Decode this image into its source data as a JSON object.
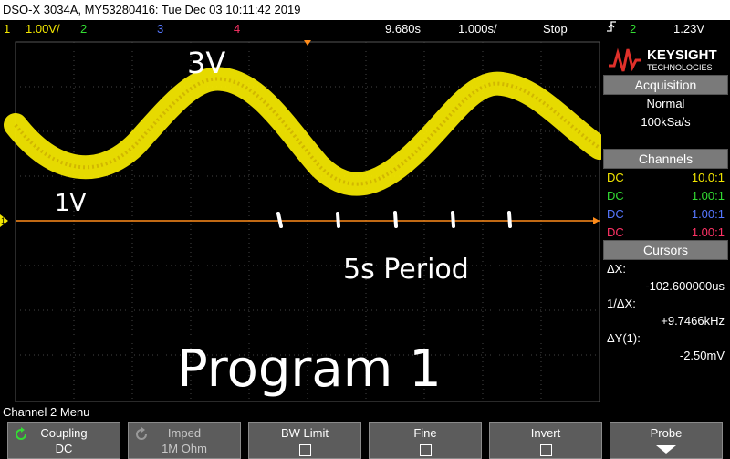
{
  "titlebar": {
    "text": "DSO-X 3034A, MY53280416: Tue Dec 03 10:11:42 2019"
  },
  "status": {
    "ch1_num": "1",
    "ch1_scale": "1.00V/",
    "ch2_num": "2",
    "ch3_num": "3",
    "ch4_num": "4",
    "delay": "9.680s",
    "timebase": "1.000s/",
    "run_state": "Stop",
    "trig_icon": "trigger-edge-icon",
    "trig_ch": "2",
    "trig_level": "1.23V"
  },
  "annotations": {
    "peak": "3V",
    "low": "1V",
    "period": "5s Period",
    "program": "Program 1"
  },
  "logo": {
    "brand": "KEYSIGHT",
    "sub": "TECHNOLOGIES"
  },
  "acquisition": {
    "title": "Acquisition",
    "mode": "Normal",
    "rate": "100kSa/s"
  },
  "channels": {
    "title": "Channels",
    "rows": [
      {
        "coupling": "DC",
        "ratio": "10.0:1",
        "color": "#f2e600"
      },
      {
        "coupling": "DC",
        "ratio": "1.00:1",
        "color": "#33dd33"
      },
      {
        "coupling": "DC",
        "ratio": "1.00:1",
        "color": "#5577ff"
      },
      {
        "coupling": "DC",
        "ratio": "1.00:1",
        "color": "#ff3366"
      }
    ]
  },
  "cursors": {
    "title": "Cursors",
    "dx_label": "ΔX:",
    "dx_value": "-102.600000us",
    "inv_label": "1/ΔX:",
    "inv_value": "+9.7466kHz",
    "dy_label": "ΔY(1):",
    "dy_value": "-2.50mV"
  },
  "menu": {
    "title": "Channel 2 Menu",
    "keys": [
      {
        "label": "Coupling",
        "value": "DC"
      },
      {
        "label": "Imped",
        "value": "1M Ohm"
      },
      {
        "label": "BW Limit",
        "value": ""
      },
      {
        "label": "Fine",
        "value": ""
      },
      {
        "label": "Invert",
        "value": ""
      },
      {
        "label": "Probe",
        "value": ""
      }
    ]
  },
  "colors": {
    "ch1": "#f2e600",
    "ch2": "#33dd33",
    "ch3": "#5577ff",
    "ch4": "#ff3366",
    "grid": "#555555",
    "marker": "#ff8c1a"
  }
}
